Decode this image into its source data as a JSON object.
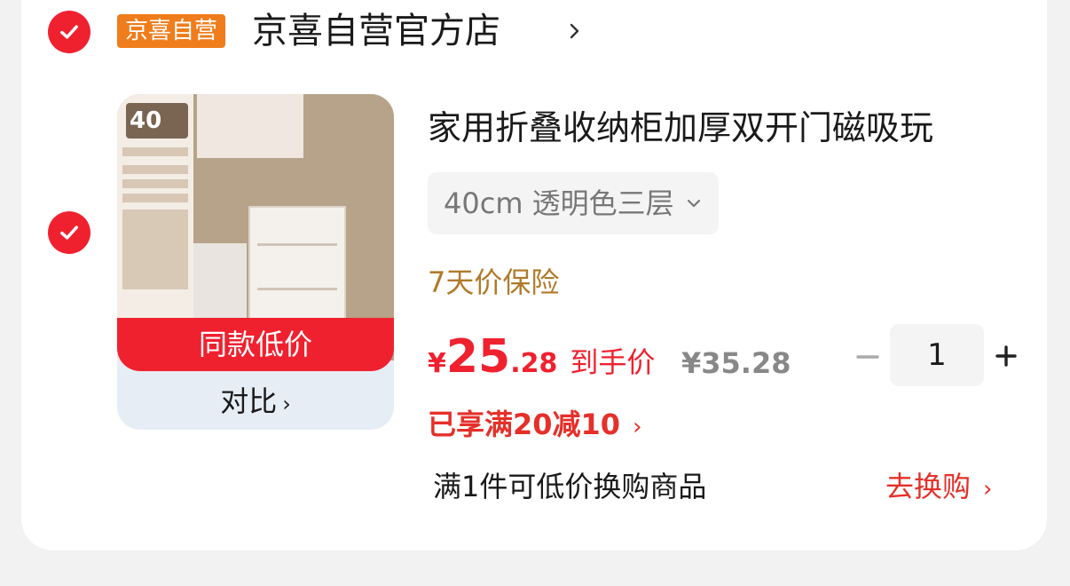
{
  "shop": {
    "badge": "京喜自营",
    "name": "京喜自营官方店"
  },
  "product": {
    "thumbnail": {
      "size_badge": "40",
      "deal_label": "同款低价",
      "compare_label": "对比"
    },
    "title": "家用折叠收纳柜加厚双开门磁吸玩",
    "spec": "40cm 透明色三层",
    "insurance": "7天价保险",
    "price": {
      "currency": "¥",
      "integer": "25",
      "decimal": ".28",
      "label": "到手价",
      "original": "¥35.28"
    },
    "quantity": "1",
    "promo": "已享满20减10",
    "exchange": {
      "text": "满1件可低价换购商品",
      "button": "去换购"
    }
  },
  "colors": {
    "accent_red": "#f0212f",
    "badge_orange": "#f07d1b",
    "insurance_gold": "#b07a2a"
  },
  "icons": {
    "check": "check-icon",
    "chevron": "chevron-right-icon",
    "dropdown": "chevron-down-icon",
    "minus": "minus-icon",
    "plus": "plus-icon"
  }
}
